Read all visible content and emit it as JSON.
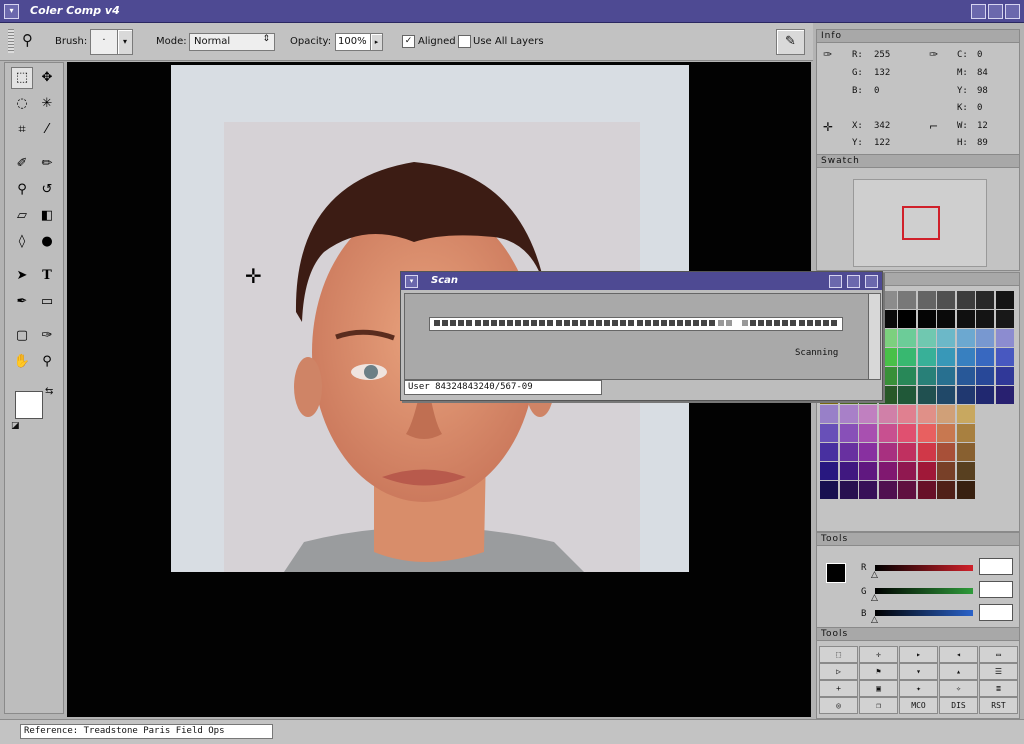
{
  "window": {
    "title": "Coler Comp v4"
  },
  "options_bar": {
    "brush_label": "Brush:",
    "brush_value": "·",
    "mode_label": "Mode:",
    "mode_value": "Normal",
    "opacity_label": "Opacity:",
    "opacity_value": "100%",
    "aligned_label": "Aligned",
    "aligned_checked": true,
    "use_all_layers_label": "Use All Layers",
    "use_all_layers_checked": false
  },
  "info": {
    "title": "Info",
    "r_label": "R:",
    "r": "255",
    "g_label": "G:",
    "g": "132",
    "b_label": "B:",
    "b": "0",
    "c_label": "C:",
    "c": "0",
    "m_label": "M:",
    "m": "84",
    "y_label": "Y:",
    "y": "98",
    "k_label": "K:",
    "k": "0",
    "x_label": "X:",
    "x": "342",
    "py_label": "Y:",
    "py": "122",
    "w_label": "W:",
    "w": "12",
    "h_label": "H:",
    "h": "89"
  },
  "swatch": {
    "title": "Swatch",
    "marker_color": "#d0202a"
  },
  "tools_rgb": {
    "title": "Tools",
    "r_label": "R",
    "g_label": "G",
    "b_label": "B"
  },
  "tools_buttons": {
    "title": "Tools",
    "mco": "MCO",
    "dis": "DIS",
    "rst": "RST"
  },
  "scan_dialog": {
    "title": "Scan",
    "status": "Scanning",
    "user_field": "User 84324843240/567-09"
  },
  "status_bar": {
    "reference": "Reference: Treadstone Paris Field Ops"
  },
  "colors": {
    "titlebar": "#4e4a93",
    "accent_red": "#d0202a"
  }
}
